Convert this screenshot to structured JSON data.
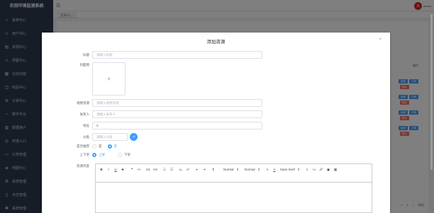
{
  "app": {
    "title": "农田环境监测系统"
  },
  "sidebar": {
    "items": [
      {
        "label": "系统中心",
        "icon": "home-icon"
      },
      {
        "label": "用户中心",
        "icon": "user-icon"
      },
      {
        "label": "资源中心",
        "icon": "book-icon"
      },
      {
        "label": "预警中心",
        "icon": "warning-icon"
      },
      {
        "label": "在线功能",
        "icon": "grid-icon"
      },
      {
        "label": "商品中心",
        "icon": "bag-icon"
      },
      {
        "label": "订单中心",
        "icon": "list-icon"
      },
      {
        "label": "数字平台",
        "icon": "chart-icon"
      },
      {
        "label": "数据用户",
        "icon": "bar-chart-icon"
      },
      {
        "label": "传感入口",
        "icon": "sensor-icon"
      },
      {
        "label": "分类管理",
        "icon": "folder-icon"
      },
      {
        "label": "地图中心",
        "icon": "map-icon"
      },
      {
        "label": "系统管理",
        "icon": "gear-icon"
      },
      {
        "label": "日志管理",
        "icon": "doc-icon"
      },
      {
        "label": "系统管理",
        "icon": "settings-icon"
      }
    ]
  },
  "header": {
    "user_initial": "A",
    "user_name": "admin"
  },
  "tabs": [
    {
      "label": "资源中心 ×"
    }
  ],
  "table": {
    "action_header": "操作",
    "rows": [
      {
        "edit": "编辑",
        "view": "详情",
        "delete": "删除"
      },
      {
        "edit": "编辑",
        "view": "详情",
        "delete": "删除"
      },
      {
        "edit": "编辑",
        "view": "详情",
        "delete": "删除"
      },
      {
        "edit": "编辑",
        "view": "详情",
        "delete": "删除"
      }
    ]
  },
  "pagination": {
    "prev": "<",
    "page": "1",
    "next": ">",
    "goto": "前往"
  },
  "dialog": {
    "title": "添加资源",
    "close": "×",
    "fields": {
      "title": {
        "label": "标题",
        "placeholder": "请输入标题"
      },
      "cover": {
        "label": "封面图",
        "plus": "+"
      },
      "video": {
        "label": "视频资源",
        "placeholder": "请输入视频资源"
      },
      "author": {
        "label": "发布人",
        "placeholder": "请输入发布人"
      },
      "address": {
        "label": "地址",
        "value": "0"
      },
      "category": {
        "label": "分类",
        "placeholder": "请输入分类",
        "button": "↗"
      },
      "recommend": {
        "label": "是否推荐",
        "options": [
          "是",
          "否"
        ],
        "selected": 1
      },
      "status": {
        "label": "上下架",
        "options": [
          "上架",
          "下架"
        ],
        "selected": 0
      },
      "content": {
        "label": "资源内容"
      }
    },
    "toolbar": {
      "bold": "B",
      "italic": "I",
      "underline": "U",
      "strike": "S",
      "quote": "❝",
      "code": "<>",
      "h1": "H1",
      "h2": "H2",
      "ol": "☷",
      "ul": "☰",
      "sub": "x₂",
      "sup": "x²",
      "indent_out": "⇤",
      "indent_in": "⇥",
      "rtl": "¶",
      "size": "Normal",
      "size_arrow": "⇕",
      "header": "Normal",
      "header_arrow": "⇕",
      "color": "A",
      "bg": "A",
      "font": "Sans Serif",
      "font_arrow": "⇕",
      "align": "≡",
      "clean": "Tx",
      "link": "🔗",
      "image": "▣",
      "video": "▦"
    }
  }
}
